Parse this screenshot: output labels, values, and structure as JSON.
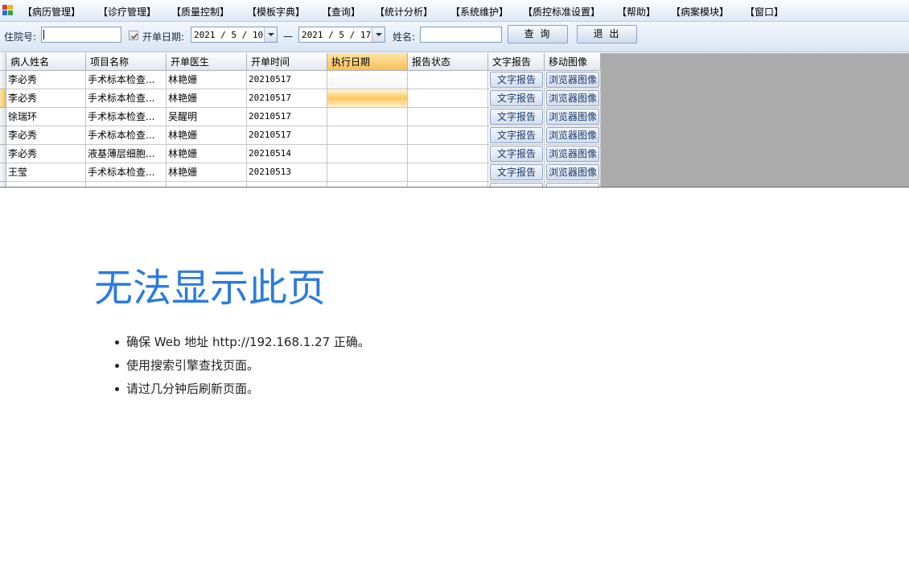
{
  "menu": {
    "items": [
      "【病历管理】",
      "【诊疗管理】",
      "【质量控制】",
      "【模板字典】",
      "【查询】",
      "【统计分析】",
      "【系统维护】",
      "【质控标准设置】",
      "【帮助】",
      "【病案模块】",
      "【窗口】"
    ]
  },
  "toolbar": {
    "inpatient_label": "住院号:",
    "inpatient_value": "",
    "order_date_label": "开单日期:",
    "date_from": "2021 / 5 / 10",
    "dash": "一",
    "date_to": "2021 / 5 / 17",
    "name_label": "姓名:",
    "name_value": "",
    "query_button": "查 询",
    "exit_button": "退 出"
  },
  "grid": {
    "columns": [
      "病人姓名",
      "项目名称",
      "开单医生",
      "开单时间",
      "执行日期",
      "报告状态",
      "文字报告",
      "移动图像"
    ],
    "text_report_button": "文字报告",
    "image_button": "浏览器图像",
    "rows": [
      {
        "patient": "李必秀",
        "item": "手术标本检查...",
        "doctor": "林艳姗",
        "time": "20210517",
        "exec_date": "",
        "status": ""
      },
      {
        "patient": "李必秀",
        "item": "手术标本检查...",
        "doctor": "林艳姗",
        "time": "20210517",
        "exec_date": "",
        "status": ""
      },
      {
        "patient": "徐瑞环",
        "item": "手术标本检查...",
        "doctor": "吴醒明",
        "time": "20210517",
        "exec_date": "",
        "status": ""
      },
      {
        "patient": "李必秀",
        "item": "手术标本检查...",
        "doctor": "林艳姗",
        "time": "20210517",
        "exec_date": "",
        "status": ""
      },
      {
        "patient": "李必秀",
        "item": "液基薄层细胞...",
        "doctor": "林艳姗",
        "time": "20210514",
        "exec_date": "",
        "status": ""
      },
      {
        "patient": "王莹",
        "item": "手术标本检查...",
        "doctor": "林艳姗",
        "time": "20210513",
        "exec_date": "",
        "status": ""
      }
    ]
  },
  "error_page": {
    "title": "无法显示此页",
    "items": [
      "确保 Web 地址 http://192.168.1.27 正确。",
      "使用搜索引擎查找页面。",
      "请过几分钟后刷新页面。"
    ]
  }
}
